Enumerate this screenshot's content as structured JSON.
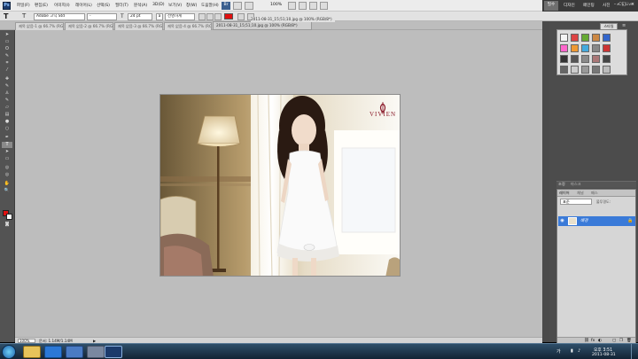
{
  "menu": {
    "items": [
      "파일(F)",
      "편집(E)",
      "이미지(I)",
      "레이어(L)",
      "선택(S)",
      "필터(T)",
      "분석(A)",
      "3D(D)",
      "보기(V)",
      "창(W)",
      "도움말(H)"
    ],
    "bridge_label": "Br",
    "zoom": "100%"
  },
  "workspace": {
    "essentials": "필수",
    "design": "디자인",
    "painting": "페인팅",
    "photography": "사진",
    "more": "»",
    "cs_live": "CS Live"
  },
  "options": {
    "font_family": "Adobe 고딕 Std",
    "font_style": "-",
    "font_size": "24 pt",
    "antialias": "선명하게",
    "text_color": "#e01010"
  },
  "document": {
    "title": "2011-08-31_15;51;10.jpg @ 100% (RGB/8*)",
    "tabs": [
      "제목 없음-1 @ 66.7% (RGB/8)",
      "제목 없음-2 @ 66.7% (RGB/8)",
      "제목 없음-3 @ 66.7% (RGB/8)",
      "제목 없음-4 @ 66.7% (RGB/8)"
    ],
    "active_tab": "2011-08-31_15;51;10.jpg @ 100% (RGB/8*)"
  },
  "photo": {
    "brand_mark": "V",
    "brand": "VIVIEN"
  },
  "status": {
    "zoom": "100%",
    "doc_info": "문서: 1.14M/1.14M"
  },
  "panels": {
    "styles_tab": "스타일",
    "swatches_count": 20,
    "adjust_tab": "조정",
    "masks_tab": "마스크",
    "layers_tab": "레이어",
    "channels_tab": "채널",
    "paths_tab": "패스",
    "blend_mode": "표준",
    "opacity_label": "불투명도:",
    "layer_name": "배경"
  },
  "taskbar": {
    "lang": "가",
    "time": "오후 3:51",
    "date": "2011-08-31"
  },
  "colors": {
    "foreground": "#e01010",
    "background": "#ffffff",
    "accent": "#3a7ad8"
  }
}
